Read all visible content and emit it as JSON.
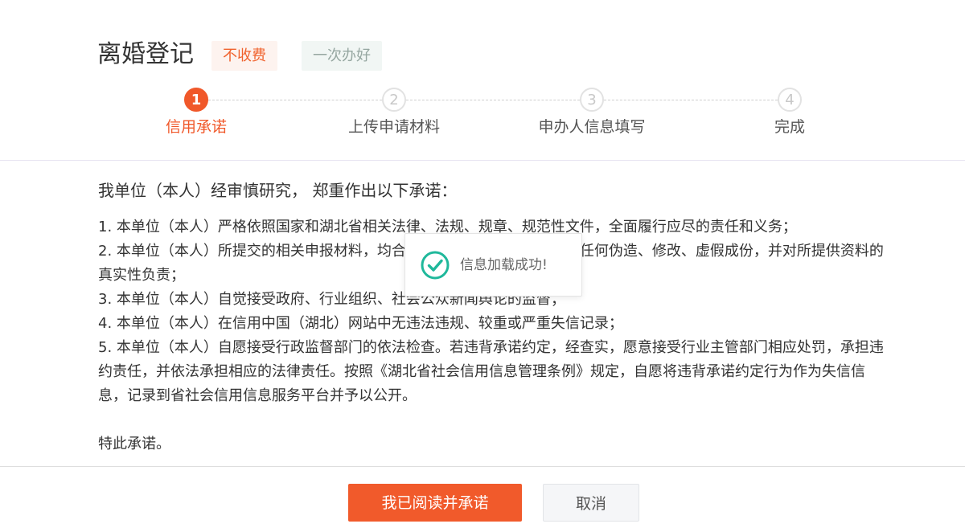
{
  "header": {
    "title": "离婚登记",
    "tags": [
      "不收费",
      "一次办好"
    ]
  },
  "steps": [
    {
      "number": "1",
      "label": "信用承诺",
      "active": true
    },
    {
      "number": "2",
      "label": "上传申请材料",
      "active": false
    },
    {
      "number": "3",
      "label": "申办人信息填写",
      "active": false
    },
    {
      "number": "4",
      "label": "完成",
      "active": false
    }
  ],
  "content": {
    "intro": "我单位（本人）经审慎研究， 郑重作出以下承诺：",
    "items": [
      "1. 本单位（本人）严格依照国家和湖北省相关法律、法规、规章、规范性文件，全面履行应尽的责任和义务；",
      "2. 本单位（本人）所提交的相关申报材料，均合法、真实、准确、有效，无任何伪造、修改、虚假成份，并对所提供资料的真实性负责；",
      "3. 本单位（本人）自觉接受政府、行业组织、社会公众新闻舆论的监督；",
      "4. 本单位（本人）在信用中国（湖北）网站中无违法违规、较重或严重失信记录；",
      "5. 本单位（本人）自愿接受行政监督部门的依法检查。若违背承诺约定，经查实，愿意接受行业主管部门相应处罚，承担违约责任，并依法承担相应的法律责任。按照《湖北省社会信用信息管理条例》规定，自愿将违背承诺约定行为作为失信信息，记录到省社会信用信息服务平台并予以公开。"
    ],
    "closing": "特此承诺。"
  },
  "footer": {
    "confirm_label": "我已阅读并承诺",
    "cancel_label": "取消"
  },
  "toast": {
    "message": "信息加载成功!",
    "icon": "check-circle-icon"
  },
  "colors": {
    "accent": "#f0582a",
    "success": "#1fb89b",
    "tag_free_bg": "#fdf3ef",
    "tag_once_bg": "#f1f6f4"
  }
}
